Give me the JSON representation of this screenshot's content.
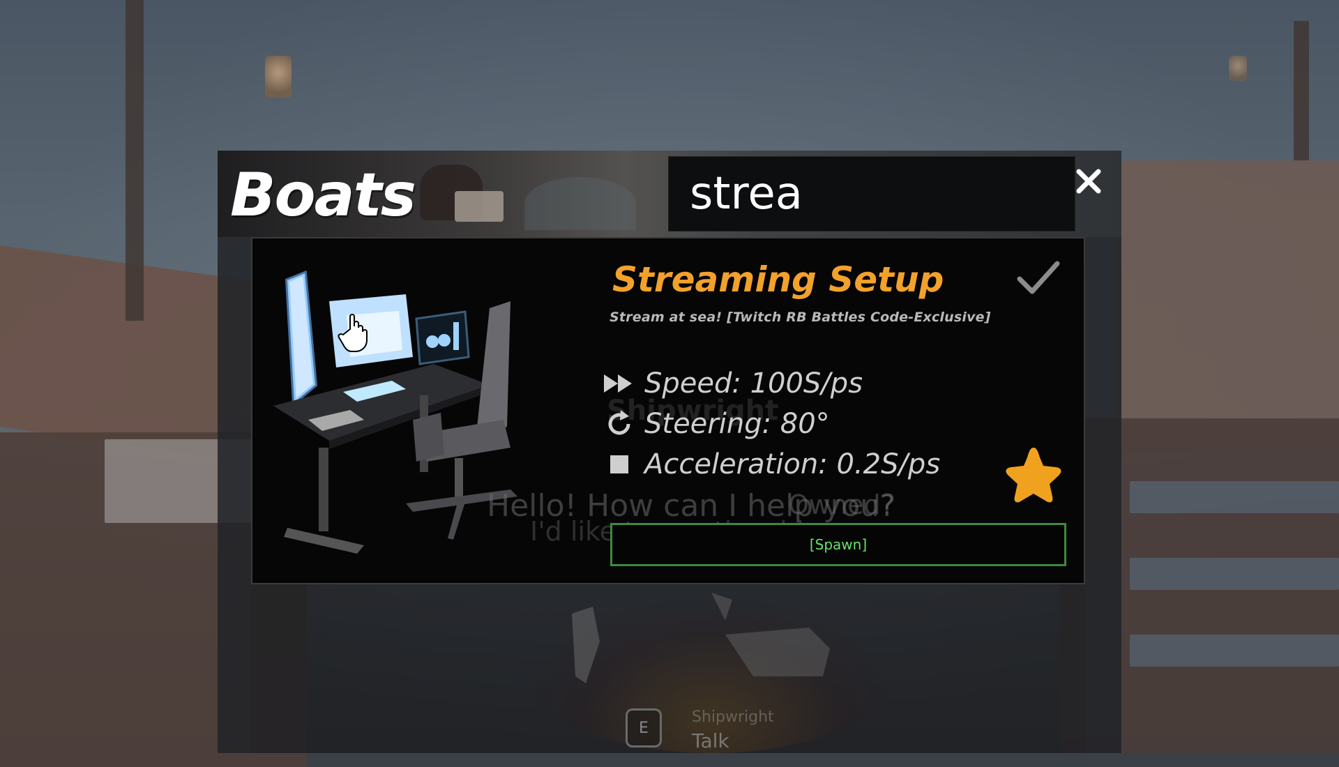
{
  "window": {
    "title": "Boats",
    "close_icon": "close-icon"
  },
  "search": {
    "value": "strea"
  },
  "boat": {
    "name": "Streaming Setup",
    "description": "Stream at sea! [Twitch RB Battles Code-Exclusive]",
    "owned": true,
    "favorited": true,
    "stats": {
      "speed": "Speed: 100S/ps",
      "steering": "Steering: 80°",
      "acceleration": "Acceleration: 0.2S/ps"
    },
    "spawn_label": "[Spawn]"
  },
  "background_dialog": {
    "npc_name": "Shipwright",
    "greeting": "Hello! How can I help you?",
    "option_1": "Owned?",
    "option_2": "I'd like to see the ships"
  },
  "interaction_prompt": {
    "key": "E",
    "title": "Shipwright",
    "action": "Talk"
  },
  "colors": {
    "boat_name": "#f2a12b",
    "spawn_border": "#3d8b3d",
    "spawn_text": "#67e36b",
    "star": "#f0a21e"
  }
}
